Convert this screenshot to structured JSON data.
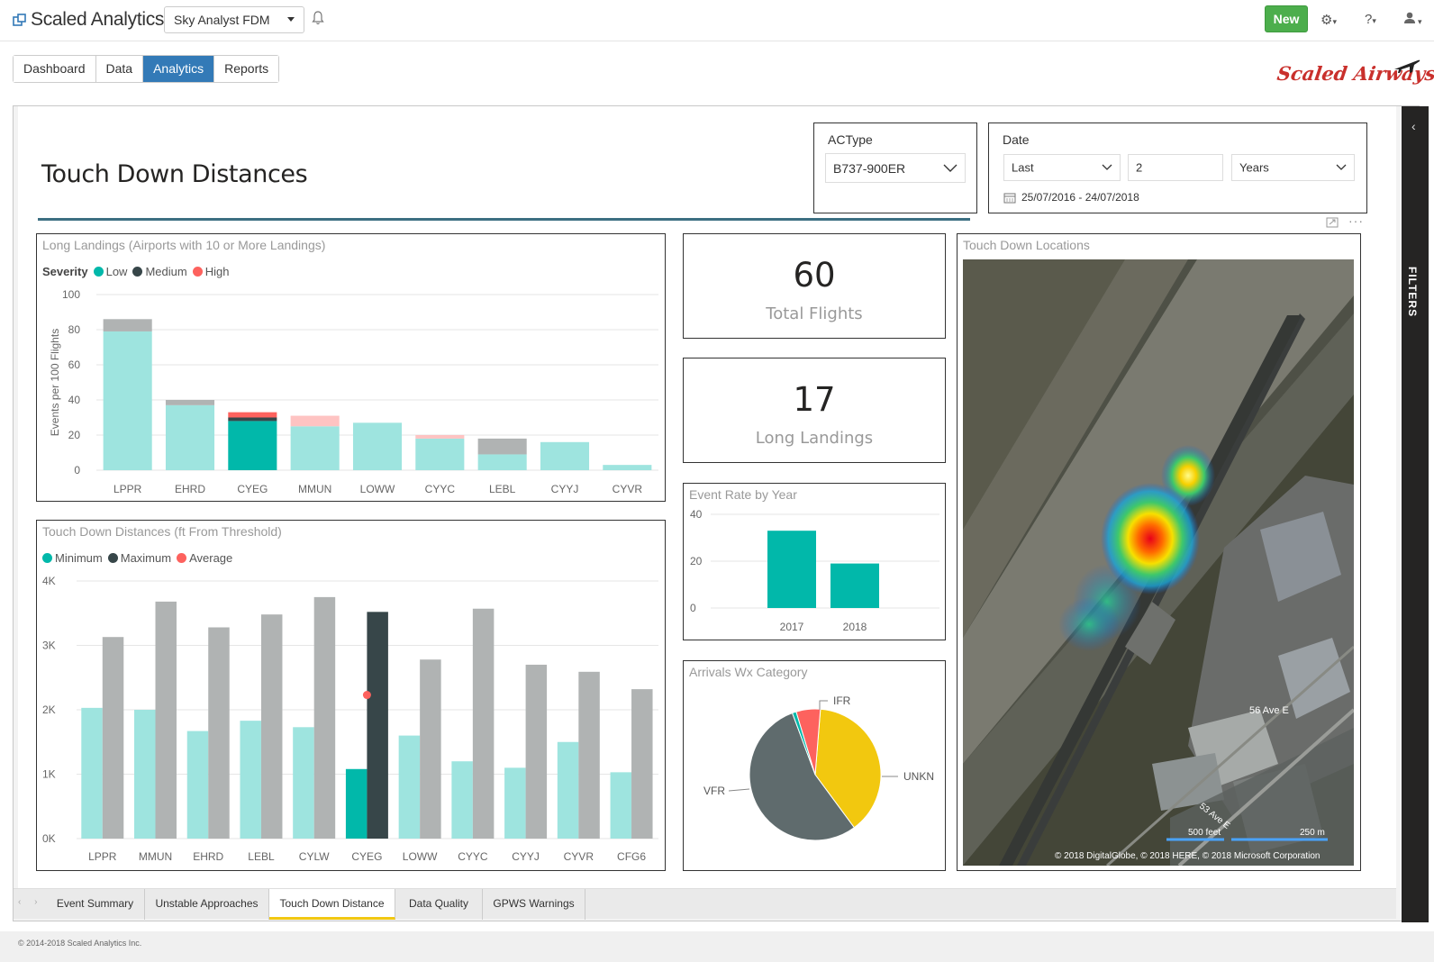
{
  "topbar": {
    "brand": "Scaled Analytics",
    "selector_value": "Sky Analyst FDM",
    "new_label": "New"
  },
  "nav": {
    "tabs": [
      {
        "label": "Dashboard",
        "active": false
      },
      {
        "label": "Data",
        "active": false
      },
      {
        "label": "Analytics",
        "active": true
      },
      {
        "label": "Reports",
        "active": false
      }
    ]
  },
  "logo_text": "Scaled Airways",
  "report": {
    "title": "Touch Down Distances",
    "filters_label": "FILTERS",
    "actype": {
      "title": "ACType",
      "value": "B737-900ER"
    },
    "date": {
      "title": "Date",
      "mode": "Last",
      "count": "2",
      "unit": "Years",
      "range": "25/07/2016 - 24/07/2018"
    },
    "total_flights": {
      "value": "60",
      "label": "Total Flights"
    },
    "long_landings": {
      "value": "17",
      "label": "Long Landings"
    },
    "map": {
      "title": "Touch Down Locations",
      "street_label": "56 Ave E",
      "street_label2": "53 Ave E",
      "scale_ft": "500 feet",
      "scale_m": "250 m",
      "attribution": "© 2018 DigitalGlobe, © 2018 HERE, © 2018 Microsoft Corporation"
    }
  },
  "chart_data": [
    {
      "type": "bar",
      "title": "Long Landings (Airports with 10 or More Landings)",
      "legend_title": "Severity",
      "ylabel": "Events per 100 Flights",
      "xlabel": "",
      "ylim": [
        0,
        100
      ],
      "yticks": [
        0,
        20,
        40,
        60,
        80,
        100
      ],
      "categories": [
        "LPPR",
        "EHRD",
        "CYEG",
        "MMUN",
        "LOWW",
        "CYYC",
        "LEBL",
        "CYYJ",
        "CYVR"
      ],
      "series": [
        {
          "name": "Low",
          "color": "#01b8aa",
          "values": [
            79,
            37,
            28,
            25,
            27,
            18,
            9,
            16,
            3
          ]
        },
        {
          "name": "Medium",
          "color": "#374649",
          "values": [
            7,
            3,
            2,
            0,
            0,
            0,
            9,
            0,
            0
          ]
        },
        {
          "name": "High",
          "color": "#fd625e",
          "values": [
            0,
            0,
            3,
            6,
            0,
            2,
            0,
            0,
            0
          ]
        }
      ],
      "highlighted": "CYEG",
      "grid": true
    },
    {
      "type": "bar",
      "title": "Touch Down Distances (ft From Threshold)",
      "ylabel": "",
      "xlabel": "",
      "ylim": [
        0,
        4000
      ],
      "yticks": [
        {
          "v": 0,
          "label": "0K"
        },
        {
          "v": 1000,
          "label": "1K"
        },
        {
          "v": 2000,
          "label": "2K"
        },
        {
          "v": 3000,
          "label": "3K"
        },
        {
          "v": 4000,
          "label": "4K"
        }
      ],
      "categories": [
        "LPPR",
        "MMUN",
        "EHRD",
        "LEBL",
        "CYLW",
        "CYEG",
        "LOWW",
        "CYYC",
        "CYYJ",
        "CYVR",
        "CFG6"
      ],
      "series": [
        {
          "name": "Minimum",
          "color": "#01b8aa",
          "values": [
            2030,
            2000,
            1670,
            1830,
            1730,
            1080,
            1600,
            1200,
            1100,
            1500,
            1030
          ]
        },
        {
          "name": "Maximum",
          "color": "#374649",
          "values": [
            3130,
            3680,
            3280,
            3480,
            3750,
            3520,
            2780,
            3570,
            2700,
            2590,
            2320
          ]
        },
        {
          "name": "Average",
          "color": "#fd625e",
          "values": [
            null,
            null,
            null,
            null,
            null,
            2230,
            null,
            null,
            null,
            null,
            null
          ]
        }
      ],
      "highlighted": "CYEG",
      "grid": true
    },
    {
      "type": "bar",
      "title": "Event Rate by Year",
      "ylim": [
        0,
        40
      ],
      "yticks": [
        0,
        20,
        40
      ],
      "categories": [
        "2017",
        "2018"
      ],
      "values": [
        33,
        19
      ],
      "color": "#01b8aa",
      "grid": true
    },
    {
      "type": "pie",
      "title": "Arrivals Wx Category",
      "labels": [
        "UNKN",
        "VFR",
        "IFR"
      ],
      "values": [
        39,
        55,
        6
      ],
      "extra_slices": [
        {
          "label": "",
          "value": 1
        }
      ],
      "colors": [
        "#f2c80f",
        "#5f6b6d",
        "#fd625e",
        "#01b8aa"
      ]
    }
  ],
  "page_tabs": [
    "Event Summary",
    "Unstable Approaches",
    "Touch Down Distance",
    "Data Quality",
    "GPWS Warnings"
  ],
  "active_page_tab": "Touch Down Distance",
  "footer": "© 2014-2018 Scaled Analytics Inc."
}
